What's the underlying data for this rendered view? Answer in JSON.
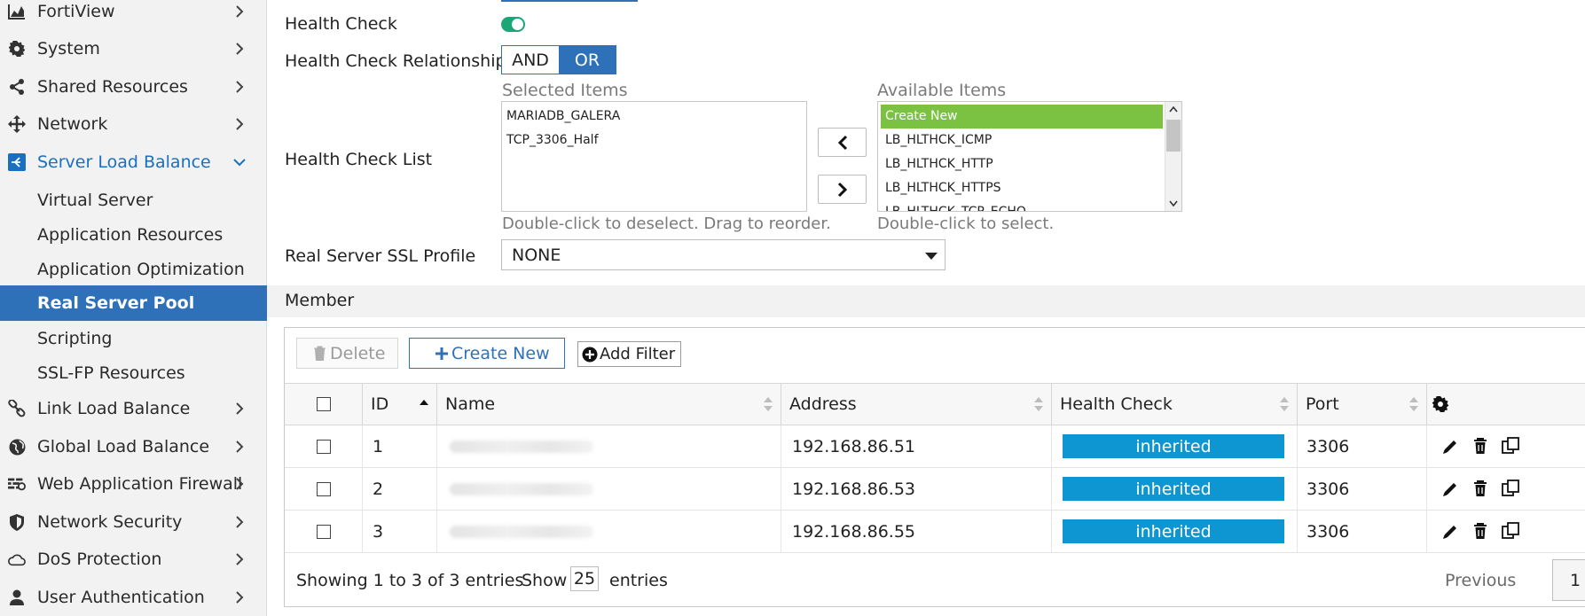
{
  "sidebar": {
    "items": [
      {
        "label": "FortiView",
        "icon": "chart-area-icon"
      },
      {
        "label": "System",
        "icon": "gear-icon"
      },
      {
        "label": "Shared Resources",
        "icon": "share-icon"
      },
      {
        "label": "Network",
        "icon": "arrows-move-icon"
      },
      {
        "label": "Server Load Balance",
        "icon": "server-load-balance-icon",
        "expanded": true,
        "children": [
          {
            "label": "Virtual Server"
          },
          {
            "label": "Application Resources"
          },
          {
            "label": "Application Optimization"
          },
          {
            "label": "Real Server Pool",
            "active": true
          },
          {
            "label": "Scripting"
          },
          {
            "label": "SSL-FP Resources"
          }
        ]
      },
      {
        "label": "Link Load Balance",
        "icon": "link-icon"
      },
      {
        "label": "Global Load Balance",
        "icon": "globe-icon"
      },
      {
        "label": "Web Application Firewall",
        "icon": "firewall-icon"
      },
      {
        "label": "Network Security",
        "icon": "shield-icon"
      },
      {
        "label": "DoS Protection",
        "icon": "cloud-icon"
      },
      {
        "label": "User Authentication",
        "icon": "user-icon"
      }
    ]
  },
  "form": {
    "health_check_label": "Health Check",
    "health_check_enabled": true,
    "relationship_label": "Health Check Relationship",
    "relationship_options": [
      "AND",
      "OR"
    ],
    "relationship_selected": "OR",
    "list_label": "Health Check List",
    "selected_title": "Selected Items",
    "selected_items": [
      "MARIADB_GALERA",
      "TCP_3306_Half"
    ],
    "selected_hint": "Double-click to deselect. Drag to reorder.",
    "available_title": "Available Items",
    "available_items": [
      "Create New",
      "LB_HLTHCK_ICMP",
      "LB_HLTHCK_HTTP",
      "LB_HLTHCK_HTTPS",
      "LB_HLTHCK_TCP_ECHO"
    ],
    "available_hint": "Double-click to select.",
    "ssl_label": "Real Server SSL Profile",
    "ssl_value": "NONE"
  },
  "member": {
    "section_title": "Member",
    "toolbar": {
      "delete": "Delete",
      "create_new": "Create New",
      "add_filter": "Add Filter"
    },
    "columns": [
      "ID",
      "Name",
      "Address",
      "Health Check",
      "Port"
    ],
    "rows": [
      {
        "id": "1",
        "address": "192.168.86.51",
        "health_check": "inherited",
        "port": "3306"
      },
      {
        "id": "2",
        "address": "192.168.86.53",
        "health_check": "inherited",
        "port": "3306"
      },
      {
        "id": "3",
        "address": "192.168.86.55",
        "health_check": "inherited",
        "port": "3306"
      }
    ],
    "footer": {
      "showing": "Showing 1 to 3 of 3 entries",
      "show": "Show",
      "page_size": "25",
      "entries": "entries",
      "previous": "Previous",
      "page": "1"
    }
  },
  "colors": {
    "accent": "#2f71b8",
    "toggle_on": "#1ba676",
    "badge": "#0d96d1",
    "highlight": "#7cc242"
  }
}
